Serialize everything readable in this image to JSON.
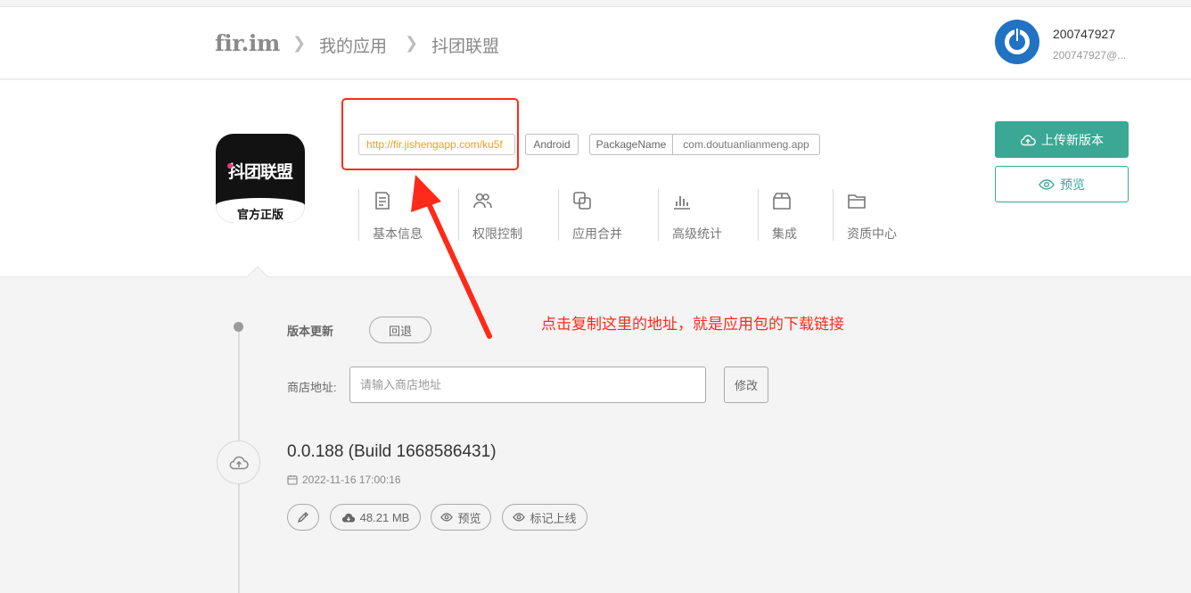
{
  "header": {
    "logo": "fir.im",
    "breadcrumbs": [
      "我的应用",
      "抖团联盟"
    ],
    "user": {
      "name": "200747927",
      "email": "200747927@..."
    }
  },
  "app": {
    "icon": {
      "title": "抖团联盟",
      "subtitle": "官方正版"
    },
    "download_url": "http://fir.jishengapp.com/ku5f",
    "platform": "Android",
    "package_label": "PackageName",
    "package_name": "com.doutuanlianmeng.app",
    "tabs": [
      {
        "label": "基本信息",
        "icon": "document-icon"
      },
      {
        "label": "权限控制",
        "icon": "users-icon"
      },
      {
        "label": "应用合并",
        "icon": "merge-icon"
      },
      {
        "label": "高级统计",
        "icon": "bar-chart-icon"
      },
      {
        "label": "集成",
        "icon": "box-icon"
      },
      {
        "label": "资质中心",
        "icon": "folder-icon"
      }
    ],
    "upload_button": "上传新版本",
    "preview_button": "预览"
  },
  "update": {
    "title": "版本更新",
    "rollback_button": "回退",
    "store_label": "商店地址:",
    "store_value": "",
    "store_placeholder": "请输入商店地址",
    "modify_button": "修改"
  },
  "release": {
    "version": "0.0.188 (Build 1668586431)",
    "date": "2022-11-16 17:00:16",
    "size": "48.21 MB",
    "preview": "预览",
    "mark_online": "标记上线"
  },
  "annotation": {
    "text": "点击复制这里的地址，就是应用包的下载链接",
    "color": "#ff2a1a"
  },
  "colors": {
    "accent": "#3aa894",
    "url_text": "#f0a020",
    "avatar": "#2172c2"
  }
}
